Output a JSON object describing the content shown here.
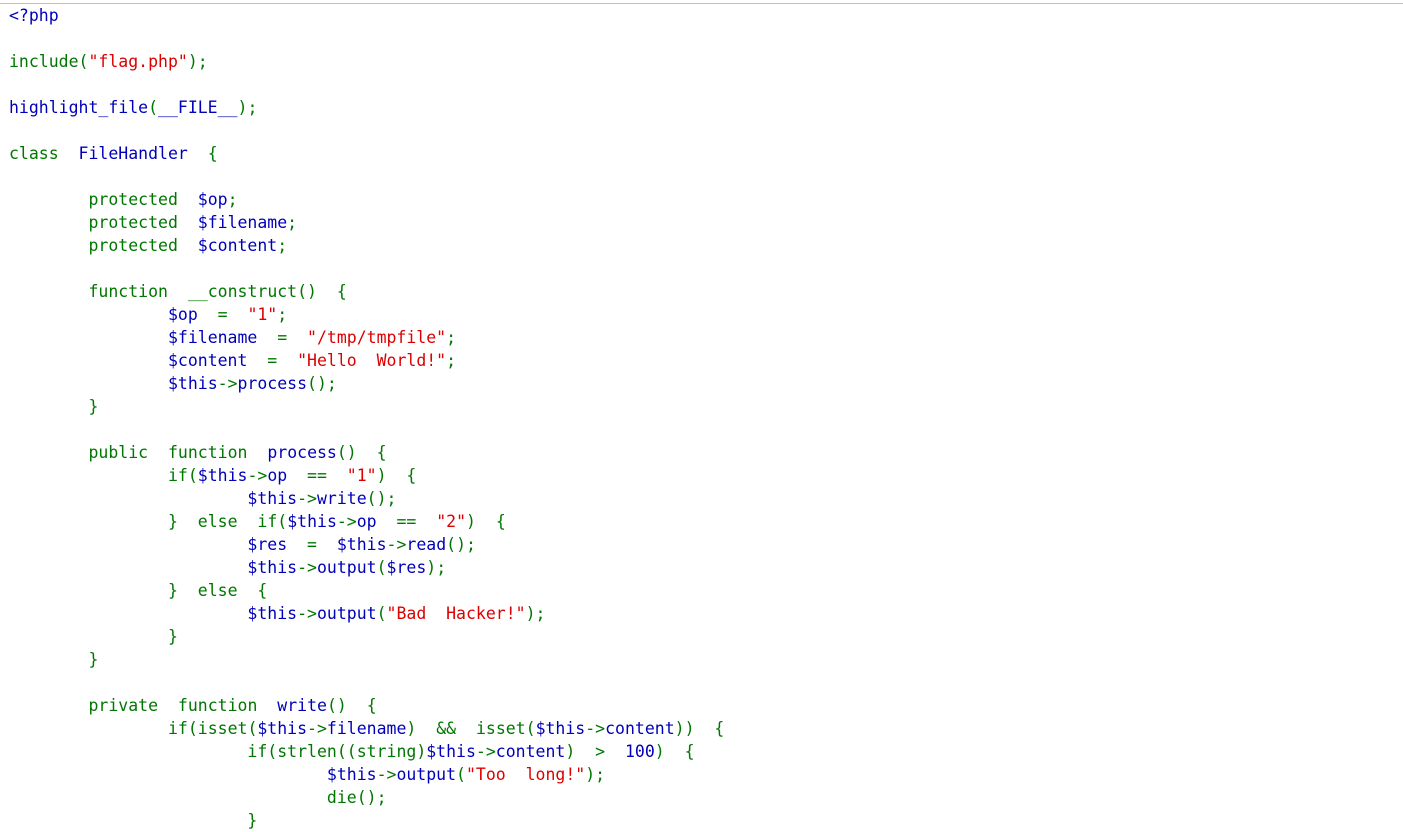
{
  "page": {
    "title": "PHP source highlight output",
    "kind": "php-highlight-file"
  },
  "colors": {
    "default": "#0000BB",
    "keyword": "#007700",
    "string": "#DD0000",
    "comment": "#FF8000",
    "html": "#000000",
    "background": "#FFFFFF",
    "rule": "#C0C0C0"
  },
  "divider": {
    "name": "horizontal-rule"
  },
  "code": {
    "language": "php",
    "font_size_px": 16.5,
    "line_height_px": 23,
    "plain_text": "<?php\n\ninclude(\"flag.php\");\n\nhighlight_file(__FILE__);\n\nclass  FileHandler  {\n\n        protected  $op;\n        protected  $filename;\n        protected  $content;\n\n        function  __construct()  {\n                $op  =  \"1\";\n                $filename  =  \"/tmp/tmpfile\";\n                $content  =  \"Hello  World!\";\n                $this->process();\n        }\n\n        public  function  process()  {\n                if($this->op  ==  \"1\")  {\n                        $this->write();\n                }  else  if($this->op  ==  \"2\")  {\n                        $res  =  $this->read();\n                        $this->output($res);\n                }  else  {\n                        $this->output(\"Bad  Hacker!\");\n                }\n        }\n\n        private  function  write()  {\n                if(isset($this->filename)  &&  isset($this->content))  {\n                        if(strlen((string)$this->content)  >  100)  {\n                                $this->output(\"Too  long!\");\n                                die();\n                        }",
    "lines": [
      {
        "n": 1,
        "tokens": [
          {
            "t": "&lt;?php",
            "c": "default"
          }
        ]
      },
      {
        "n": 2,
        "tokens": []
      },
      {
        "n": 3,
        "tokens": [
          {
            "t": "include",
            "c": "keyword"
          },
          {
            "t": "(",
            "c": "keyword"
          },
          {
            "t": "\"flag.php\"",
            "c": "string"
          },
          {
            "t": ")",
            "c": "keyword"
          },
          {
            "t": ";",
            "c": "keyword"
          }
        ]
      },
      {
        "n": 4,
        "tokens": []
      },
      {
        "n": 5,
        "tokens": [
          {
            "t": "highlight_file",
            "c": "default"
          },
          {
            "t": "(",
            "c": "keyword"
          },
          {
            "t": "__FILE__",
            "c": "default"
          },
          {
            "t": ")",
            "c": "keyword"
          },
          {
            "t": ";",
            "c": "keyword"
          }
        ]
      },
      {
        "n": 6,
        "tokens": []
      },
      {
        "n": 7,
        "tokens": [
          {
            "t": "class",
            "c": "keyword"
          },
          {
            "t": "  ",
            "c": "keyword"
          },
          {
            "t": "FileHandler",
            "c": "default"
          },
          {
            "t": "  ",
            "c": "keyword"
          },
          {
            "t": "{",
            "c": "keyword"
          }
        ]
      },
      {
        "n": 8,
        "tokens": []
      },
      {
        "n": 9,
        "tokens": [
          {
            "t": "        ",
            "c": "keyword"
          },
          {
            "t": "protected",
            "c": "keyword"
          },
          {
            "t": "  ",
            "c": "keyword"
          },
          {
            "t": "$op",
            "c": "default"
          },
          {
            "t": ";",
            "c": "keyword"
          }
        ]
      },
      {
        "n": 10,
        "tokens": [
          {
            "t": "        ",
            "c": "keyword"
          },
          {
            "t": "protected",
            "c": "keyword"
          },
          {
            "t": "  ",
            "c": "keyword"
          },
          {
            "t": "$filename",
            "c": "default"
          },
          {
            "t": ";",
            "c": "keyword"
          }
        ]
      },
      {
        "n": 11,
        "tokens": [
          {
            "t": "        ",
            "c": "keyword"
          },
          {
            "t": "protected",
            "c": "keyword"
          },
          {
            "t": "  ",
            "c": "keyword"
          },
          {
            "t": "$content",
            "c": "default"
          },
          {
            "t": ";",
            "c": "keyword"
          }
        ]
      },
      {
        "n": 12,
        "tokens": []
      },
      {
        "n": 13,
        "tokens": [
          {
            "t": "        ",
            "c": "keyword"
          },
          {
            "t": "function",
            "c": "keyword"
          },
          {
            "t": "  ",
            "c": "keyword"
          },
          {
            "t": "__construct",
            "c": "keyword"
          },
          {
            "t": "()",
            "c": "keyword"
          },
          {
            "t": "  ",
            "c": "keyword"
          },
          {
            "t": "{",
            "c": "keyword"
          }
        ]
      },
      {
        "n": 14,
        "tokens": [
          {
            "t": "                ",
            "c": "keyword"
          },
          {
            "t": "$op",
            "c": "default"
          },
          {
            "t": "  =  ",
            "c": "keyword"
          },
          {
            "t": "\"1\"",
            "c": "string"
          },
          {
            "t": ";",
            "c": "keyword"
          }
        ]
      },
      {
        "n": 15,
        "tokens": [
          {
            "t": "                ",
            "c": "keyword"
          },
          {
            "t": "$filename",
            "c": "default"
          },
          {
            "t": "  =  ",
            "c": "keyword"
          },
          {
            "t": "\"/tmp/tmpfile\"",
            "c": "string"
          },
          {
            "t": ";",
            "c": "keyword"
          }
        ]
      },
      {
        "n": 16,
        "tokens": [
          {
            "t": "                ",
            "c": "keyword"
          },
          {
            "t": "$content",
            "c": "default"
          },
          {
            "t": "  =  ",
            "c": "keyword"
          },
          {
            "t": "\"Hello  World!\"",
            "c": "string"
          },
          {
            "t": ";",
            "c": "keyword"
          }
        ]
      },
      {
        "n": 17,
        "tokens": [
          {
            "t": "                ",
            "c": "keyword"
          },
          {
            "t": "$this",
            "c": "default"
          },
          {
            "t": "->",
            "c": "keyword"
          },
          {
            "t": "process",
            "c": "default"
          },
          {
            "t": "()",
            "c": "keyword"
          },
          {
            "t": ";",
            "c": "keyword"
          }
        ]
      },
      {
        "n": 18,
        "tokens": [
          {
            "t": "        ",
            "c": "keyword"
          },
          {
            "t": "}",
            "c": "keyword"
          }
        ]
      },
      {
        "n": 19,
        "tokens": []
      },
      {
        "n": 20,
        "tokens": [
          {
            "t": "        ",
            "c": "keyword"
          },
          {
            "t": "public",
            "c": "keyword"
          },
          {
            "t": "  ",
            "c": "keyword"
          },
          {
            "t": "function",
            "c": "keyword"
          },
          {
            "t": "  ",
            "c": "keyword"
          },
          {
            "t": "process",
            "c": "default"
          },
          {
            "t": "()",
            "c": "keyword"
          },
          {
            "t": "  ",
            "c": "keyword"
          },
          {
            "t": "{",
            "c": "keyword"
          }
        ]
      },
      {
        "n": 21,
        "tokens": [
          {
            "t": "                ",
            "c": "keyword"
          },
          {
            "t": "if",
            "c": "keyword"
          },
          {
            "t": "(",
            "c": "keyword"
          },
          {
            "t": "$this",
            "c": "default"
          },
          {
            "t": "->",
            "c": "keyword"
          },
          {
            "t": "op",
            "c": "default"
          },
          {
            "t": "  ==  ",
            "c": "keyword"
          },
          {
            "t": "\"1\"",
            "c": "string"
          },
          {
            "t": ")",
            "c": "keyword"
          },
          {
            "t": "  ",
            "c": "keyword"
          },
          {
            "t": "{",
            "c": "keyword"
          }
        ]
      },
      {
        "n": 22,
        "tokens": [
          {
            "t": "                        ",
            "c": "keyword"
          },
          {
            "t": "$this",
            "c": "default"
          },
          {
            "t": "->",
            "c": "keyword"
          },
          {
            "t": "write",
            "c": "default"
          },
          {
            "t": "()",
            "c": "keyword"
          },
          {
            "t": ";",
            "c": "keyword"
          }
        ]
      },
      {
        "n": 23,
        "tokens": [
          {
            "t": "                ",
            "c": "keyword"
          },
          {
            "t": "}",
            "c": "keyword"
          },
          {
            "t": "  ",
            "c": "keyword"
          },
          {
            "t": "else",
            "c": "keyword"
          },
          {
            "t": "  ",
            "c": "keyword"
          },
          {
            "t": "if",
            "c": "keyword"
          },
          {
            "t": "(",
            "c": "keyword"
          },
          {
            "t": "$this",
            "c": "default"
          },
          {
            "t": "->",
            "c": "keyword"
          },
          {
            "t": "op",
            "c": "default"
          },
          {
            "t": "  ==  ",
            "c": "keyword"
          },
          {
            "t": "\"2\"",
            "c": "string"
          },
          {
            "t": ")",
            "c": "keyword"
          },
          {
            "t": "  ",
            "c": "keyword"
          },
          {
            "t": "{",
            "c": "keyword"
          }
        ]
      },
      {
        "n": 24,
        "tokens": [
          {
            "t": "                        ",
            "c": "keyword"
          },
          {
            "t": "$res",
            "c": "default"
          },
          {
            "t": "  =  ",
            "c": "keyword"
          },
          {
            "t": "$this",
            "c": "default"
          },
          {
            "t": "->",
            "c": "keyword"
          },
          {
            "t": "read",
            "c": "default"
          },
          {
            "t": "()",
            "c": "keyword"
          },
          {
            "t": ";",
            "c": "keyword"
          }
        ]
      },
      {
        "n": 25,
        "tokens": [
          {
            "t": "                        ",
            "c": "keyword"
          },
          {
            "t": "$this",
            "c": "default"
          },
          {
            "t": "->",
            "c": "keyword"
          },
          {
            "t": "output",
            "c": "default"
          },
          {
            "t": "(",
            "c": "keyword"
          },
          {
            "t": "$res",
            "c": "default"
          },
          {
            "t": ")",
            "c": "keyword"
          },
          {
            "t": ";",
            "c": "keyword"
          }
        ]
      },
      {
        "n": 26,
        "tokens": [
          {
            "t": "                ",
            "c": "keyword"
          },
          {
            "t": "}",
            "c": "keyword"
          },
          {
            "t": "  ",
            "c": "keyword"
          },
          {
            "t": "else",
            "c": "keyword"
          },
          {
            "t": "  ",
            "c": "keyword"
          },
          {
            "t": "{",
            "c": "keyword"
          }
        ]
      },
      {
        "n": 27,
        "tokens": [
          {
            "t": "                        ",
            "c": "keyword"
          },
          {
            "t": "$this",
            "c": "default"
          },
          {
            "t": "->",
            "c": "keyword"
          },
          {
            "t": "output",
            "c": "default"
          },
          {
            "t": "(",
            "c": "keyword"
          },
          {
            "t": "\"Bad  Hacker!\"",
            "c": "string"
          },
          {
            "t": ")",
            "c": "keyword"
          },
          {
            "t": ";",
            "c": "keyword"
          }
        ]
      },
      {
        "n": 28,
        "tokens": [
          {
            "t": "                ",
            "c": "keyword"
          },
          {
            "t": "}",
            "c": "keyword"
          }
        ]
      },
      {
        "n": 29,
        "tokens": [
          {
            "t": "        ",
            "c": "keyword"
          },
          {
            "t": "}",
            "c": "keyword"
          }
        ]
      },
      {
        "n": 30,
        "tokens": []
      },
      {
        "n": 31,
        "tokens": [
          {
            "t": "        ",
            "c": "keyword"
          },
          {
            "t": "private",
            "c": "keyword"
          },
          {
            "t": "  ",
            "c": "keyword"
          },
          {
            "t": "function",
            "c": "keyword"
          },
          {
            "t": "  ",
            "c": "keyword"
          },
          {
            "t": "write",
            "c": "default"
          },
          {
            "t": "()",
            "c": "keyword"
          },
          {
            "t": "  ",
            "c": "keyword"
          },
          {
            "t": "{",
            "c": "keyword"
          }
        ]
      },
      {
        "n": 32,
        "tokens": [
          {
            "t": "                ",
            "c": "keyword"
          },
          {
            "t": "if",
            "c": "keyword"
          },
          {
            "t": "(",
            "c": "keyword"
          },
          {
            "t": "isset",
            "c": "keyword"
          },
          {
            "t": "(",
            "c": "keyword"
          },
          {
            "t": "$this",
            "c": "default"
          },
          {
            "t": "->",
            "c": "keyword"
          },
          {
            "t": "filename",
            "c": "default"
          },
          {
            "t": ")",
            "c": "keyword"
          },
          {
            "t": "  &&  ",
            "c": "keyword"
          },
          {
            "t": "isset",
            "c": "keyword"
          },
          {
            "t": "(",
            "c": "keyword"
          },
          {
            "t": "$this",
            "c": "default"
          },
          {
            "t": "->",
            "c": "keyword"
          },
          {
            "t": "content",
            "c": "default"
          },
          {
            "t": "))",
            "c": "keyword"
          },
          {
            "t": "  ",
            "c": "keyword"
          },
          {
            "t": "{",
            "c": "keyword"
          }
        ]
      },
      {
        "n": 33,
        "tokens": [
          {
            "t": "                        ",
            "c": "keyword"
          },
          {
            "t": "if",
            "c": "keyword"
          },
          {
            "t": "(",
            "c": "keyword"
          },
          {
            "t": "strlen",
            "c": "keyword"
          },
          {
            "t": "((string)",
            "c": "keyword"
          },
          {
            "t": "$this",
            "c": "default"
          },
          {
            "t": "->",
            "c": "keyword"
          },
          {
            "t": "content",
            "c": "default"
          },
          {
            "t": ")",
            "c": "keyword"
          },
          {
            "t": "  &gt;  ",
            "c": "keyword"
          },
          {
            "t": "100",
            "c": "default"
          },
          {
            "t": ")",
            "c": "keyword"
          },
          {
            "t": "  ",
            "c": "keyword"
          },
          {
            "t": "{",
            "c": "keyword"
          }
        ]
      },
      {
        "n": 34,
        "tokens": [
          {
            "t": "                                ",
            "c": "keyword"
          },
          {
            "t": "$this",
            "c": "default"
          },
          {
            "t": "->",
            "c": "keyword"
          },
          {
            "t": "output",
            "c": "default"
          },
          {
            "t": "(",
            "c": "keyword"
          },
          {
            "t": "\"Too  long!\"",
            "c": "string"
          },
          {
            "t": ")",
            "c": "keyword"
          },
          {
            "t": ";",
            "c": "keyword"
          }
        ]
      },
      {
        "n": 35,
        "tokens": [
          {
            "t": "                                ",
            "c": "keyword"
          },
          {
            "t": "die",
            "c": "keyword"
          },
          {
            "t": "()",
            "c": "keyword"
          },
          {
            "t": ";",
            "c": "keyword"
          }
        ]
      },
      {
        "n": 36,
        "tokens": [
          {
            "t": "                        ",
            "c": "keyword"
          },
          {
            "t": "}",
            "c": "keyword"
          }
        ]
      }
    ]
  }
}
